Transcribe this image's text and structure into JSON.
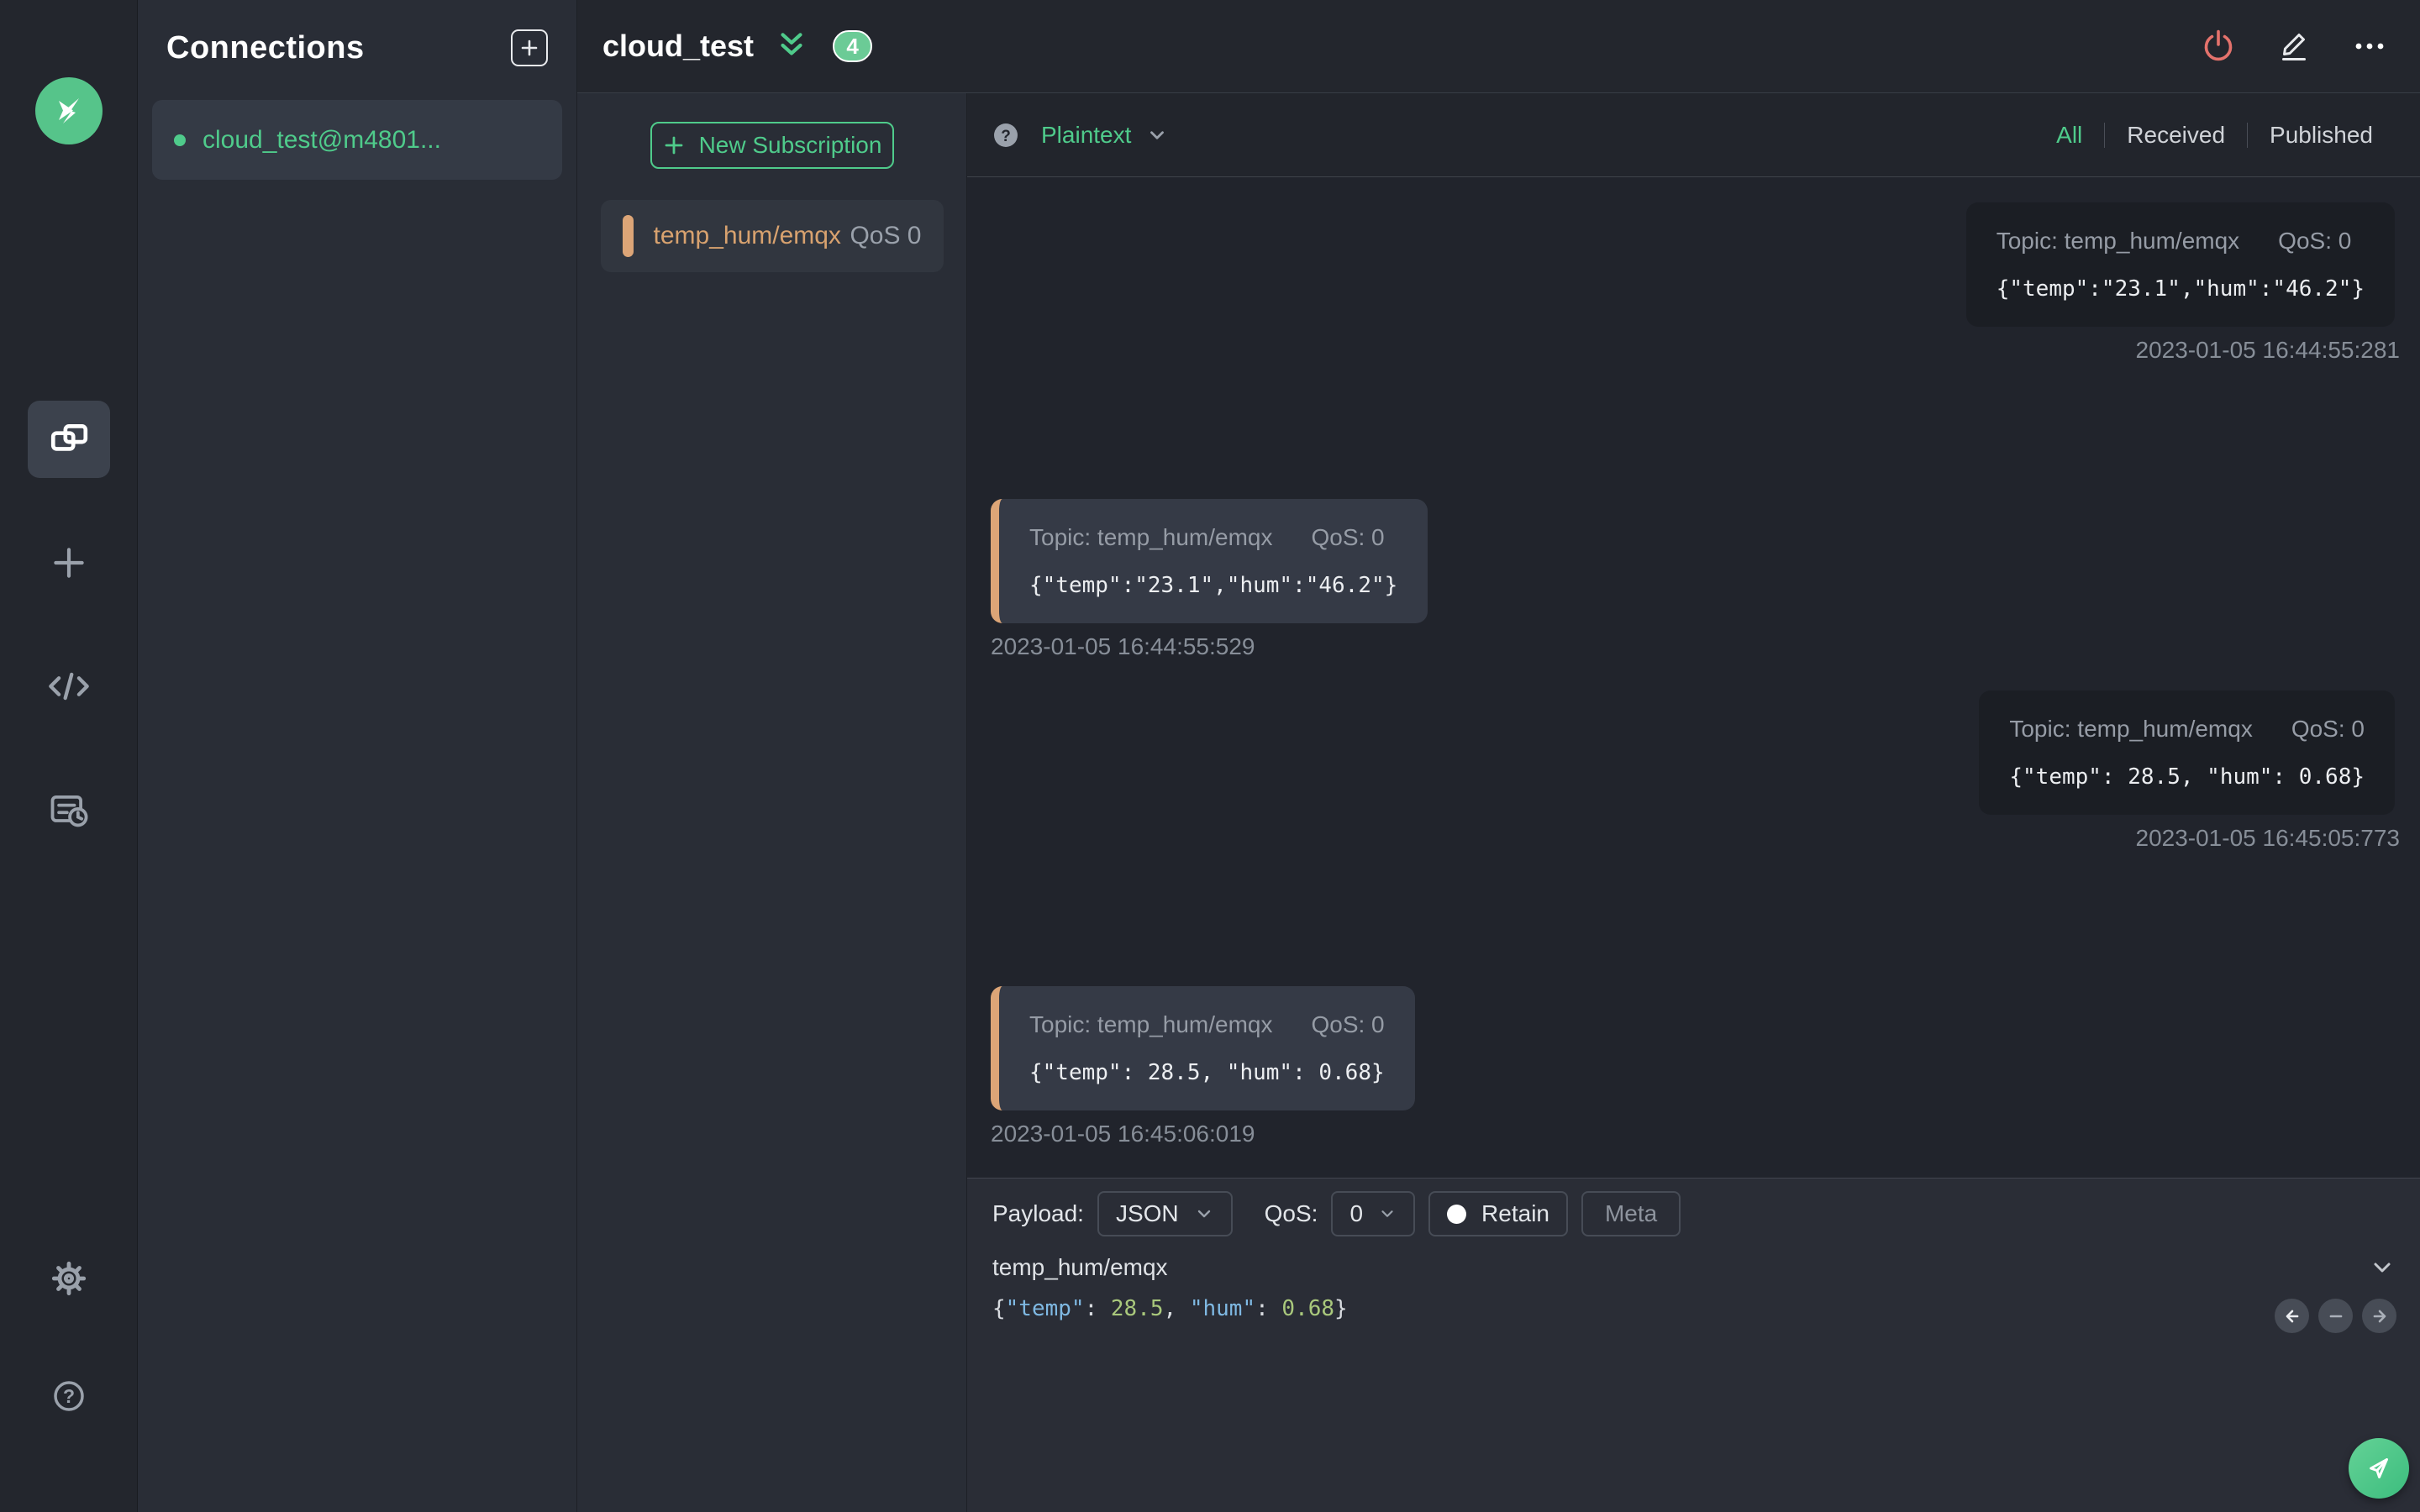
{
  "colors": {
    "accent_green": "#4fcb8b",
    "badge_green": "#6bcb96",
    "accent_tan": "#dca577",
    "power_red": "#e4726c",
    "json_key_blue": "#7fb9e3",
    "json_num_green": "#a9c87c"
  },
  "sidebar": {
    "icons": [
      "mqttx-logo",
      "connections",
      "new-connection",
      "script",
      "log",
      "settings",
      "help"
    ]
  },
  "connections": {
    "title": "Connections",
    "items": [
      {
        "name": "cloud_test@m4801...",
        "status": "connected"
      }
    ]
  },
  "header": {
    "title": "cloud_test",
    "badge": "4"
  },
  "subscriptions": {
    "new_button": "New Subscription",
    "items": [
      {
        "topic": "temp_hum/emqx",
        "qos": "QoS 0"
      }
    ]
  },
  "messages": {
    "toolbar": {
      "format": "Plaintext",
      "filters": [
        "All",
        "Received",
        "Published"
      ],
      "active_filter": "All"
    },
    "list": [
      {
        "side": "right",
        "topic_label": "Topic: temp_hum/emqx",
        "qos_label": "QoS: 0",
        "payload": "{\"temp\":\"23.1\",\"hum\":\"46.2\"}",
        "time": "2023-01-05 16:44:55:281"
      },
      {
        "side": "left",
        "topic_label": "Topic: temp_hum/emqx",
        "qos_label": "QoS: 0",
        "payload": "{\"temp\":\"23.1\",\"hum\":\"46.2\"}",
        "time": "2023-01-05 16:44:55:529"
      },
      {
        "side": "right",
        "topic_label": "Topic: temp_hum/emqx",
        "qos_label": "QoS: 0",
        "payload": "{\"temp\": 28.5, \"hum\": 0.68}",
        "time": "2023-01-05 16:45:05:773"
      },
      {
        "side": "left",
        "topic_label": "Topic: temp_hum/emqx",
        "qos_label": "QoS: 0",
        "payload": "{\"temp\": 28.5, \"hum\": 0.68}",
        "time": "2023-01-05 16:45:06:019"
      }
    ]
  },
  "publish": {
    "payload_label": "Payload:",
    "payload_format": "JSON",
    "qos_label": "QoS:",
    "qos_value": "0",
    "retain_label": "Retain",
    "meta_label": "Meta",
    "topic": "temp_hum/emqx",
    "editor_segments": [
      {
        "text": "{",
        "type": "punct"
      },
      {
        "text": "\"temp\"",
        "type": "key"
      },
      {
        "text": ": ",
        "type": "punct"
      },
      {
        "text": "28.5",
        "type": "num"
      },
      {
        "text": ", ",
        "type": "punct"
      },
      {
        "text": "\"hum\"",
        "type": "key"
      },
      {
        "text": ": ",
        "type": "punct"
      },
      {
        "text": "0.68",
        "type": "num"
      },
      {
        "text": "}",
        "type": "punct"
      }
    ]
  }
}
